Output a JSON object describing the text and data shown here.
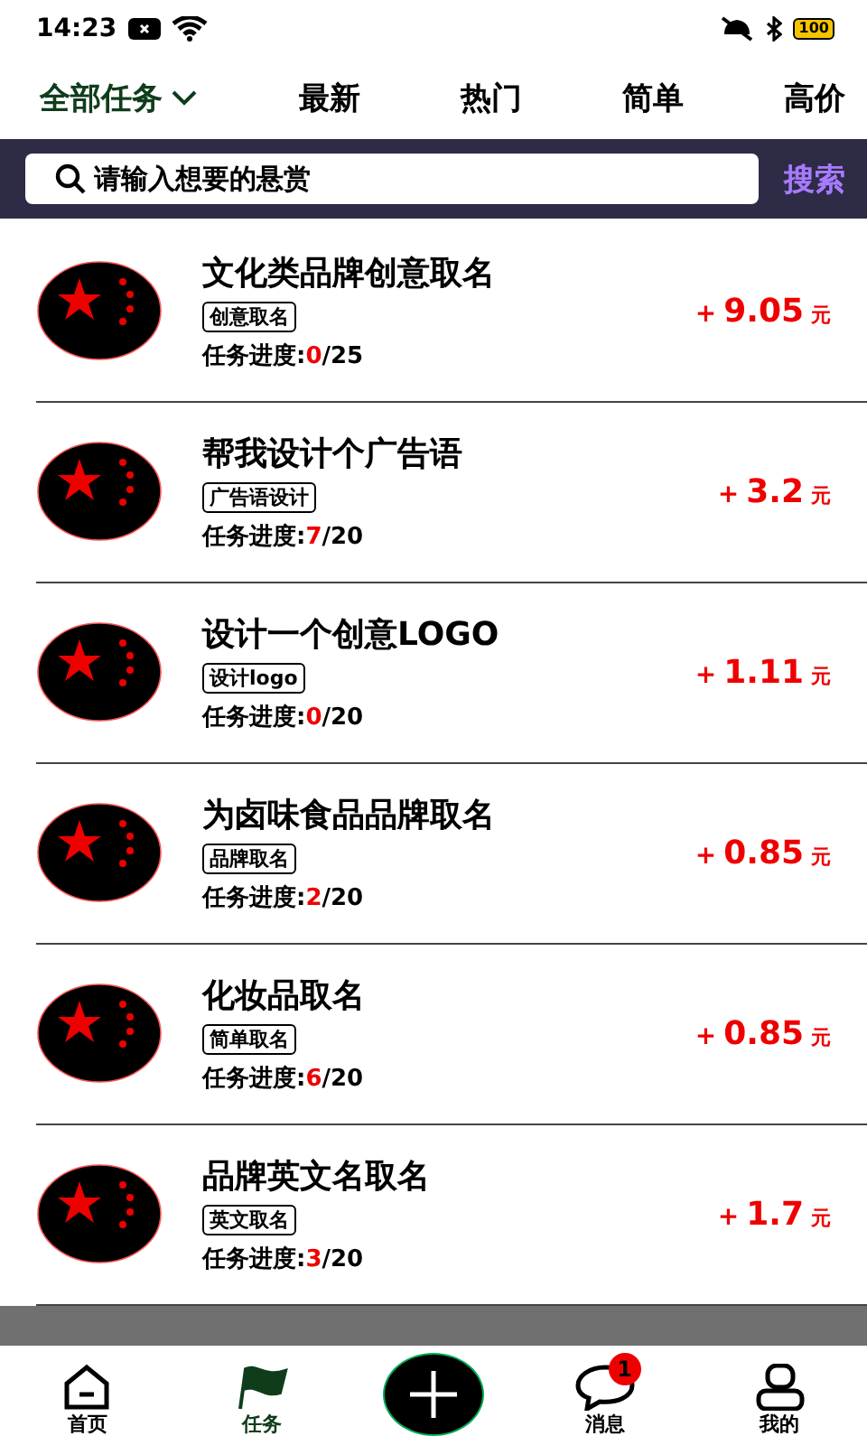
{
  "status_bar": {
    "time": "14:23",
    "battery": "100"
  },
  "tabs": [
    {
      "label": "全部任务",
      "selected": true,
      "dropdown": true
    },
    {
      "label": "最新",
      "selected": false,
      "dropdown": false
    },
    {
      "label": "热门",
      "selected": false,
      "dropdown": false
    },
    {
      "label": "简单",
      "selected": false,
      "dropdown": false
    },
    {
      "label": "高价",
      "selected": false,
      "dropdown": false
    }
  ],
  "search": {
    "placeholder": "请输入想要的悬赏",
    "button": "搜索"
  },
  "tasks": [
    {
      "title": "文化类品牌创意取名",
      "tag": "创意取名",
      "progress_label": "任务进度:",
      "done": "0",
      "total": "/25",
      "sign": "+",
      "reward": "9.05",
      "unit": "元"
    },
    {
      "title": "帮我设计个广告语",
      "tag": "广告语设计",
      "progress_label": "任务进度:",
      "done": "7",
      "total": "/20",
      "sign": "+",
      "reward": "3.2",
      "unit": "元"
    },
    {
      "title": "设计一个创意LOGO",
      "tag": "设计logo",
      "progress_label": "任务进度:",
      "done": "0",
      "total": "/20",
      "sign": "+",
      "reward": "1.11",
      "unit": "元"
    },
    {
      "title": "为卤味食品品牌取名",
      "tag": "品牌取名",
      "progress_label": "任务进度:",
      "done": "2",
      "total": "/20",
      "sign": "+",
      "reward": "0.85",
      "unit": "元"
    },
    {
      "title": "化妆品取名",
      "tag": "简单取名",
      "progress_label": "任务进度:",
      "done": "6",
      "total": "/20",
      "sign": "+",
      "reward": "0.85",
      "unit": "元"
    },
    {
      "title": "品牌英文名取名",
      "tag": "英文取名",
      "progress_label": "任务进度:",
      "done": "3",
      "total": "/20",
      "sign": "+",
      "reward": "1.7",
      "unit": "元"
    }
  ],
  "nav": [
    {
      "kind": "home",
      "label": "首页",
      "selected": false
    },
    {
      "kind": "flag",
      "label": "任务",
      "selected": true
    },
    {
      "kind": "add"
    },
    {
      "kind": "message",
      "label": "消息",
      "selected": false,
      "badge": "1"
    },
    {
      "kind": "user",
      "label": "我的",
      "selected": false
    }
  ]
}
